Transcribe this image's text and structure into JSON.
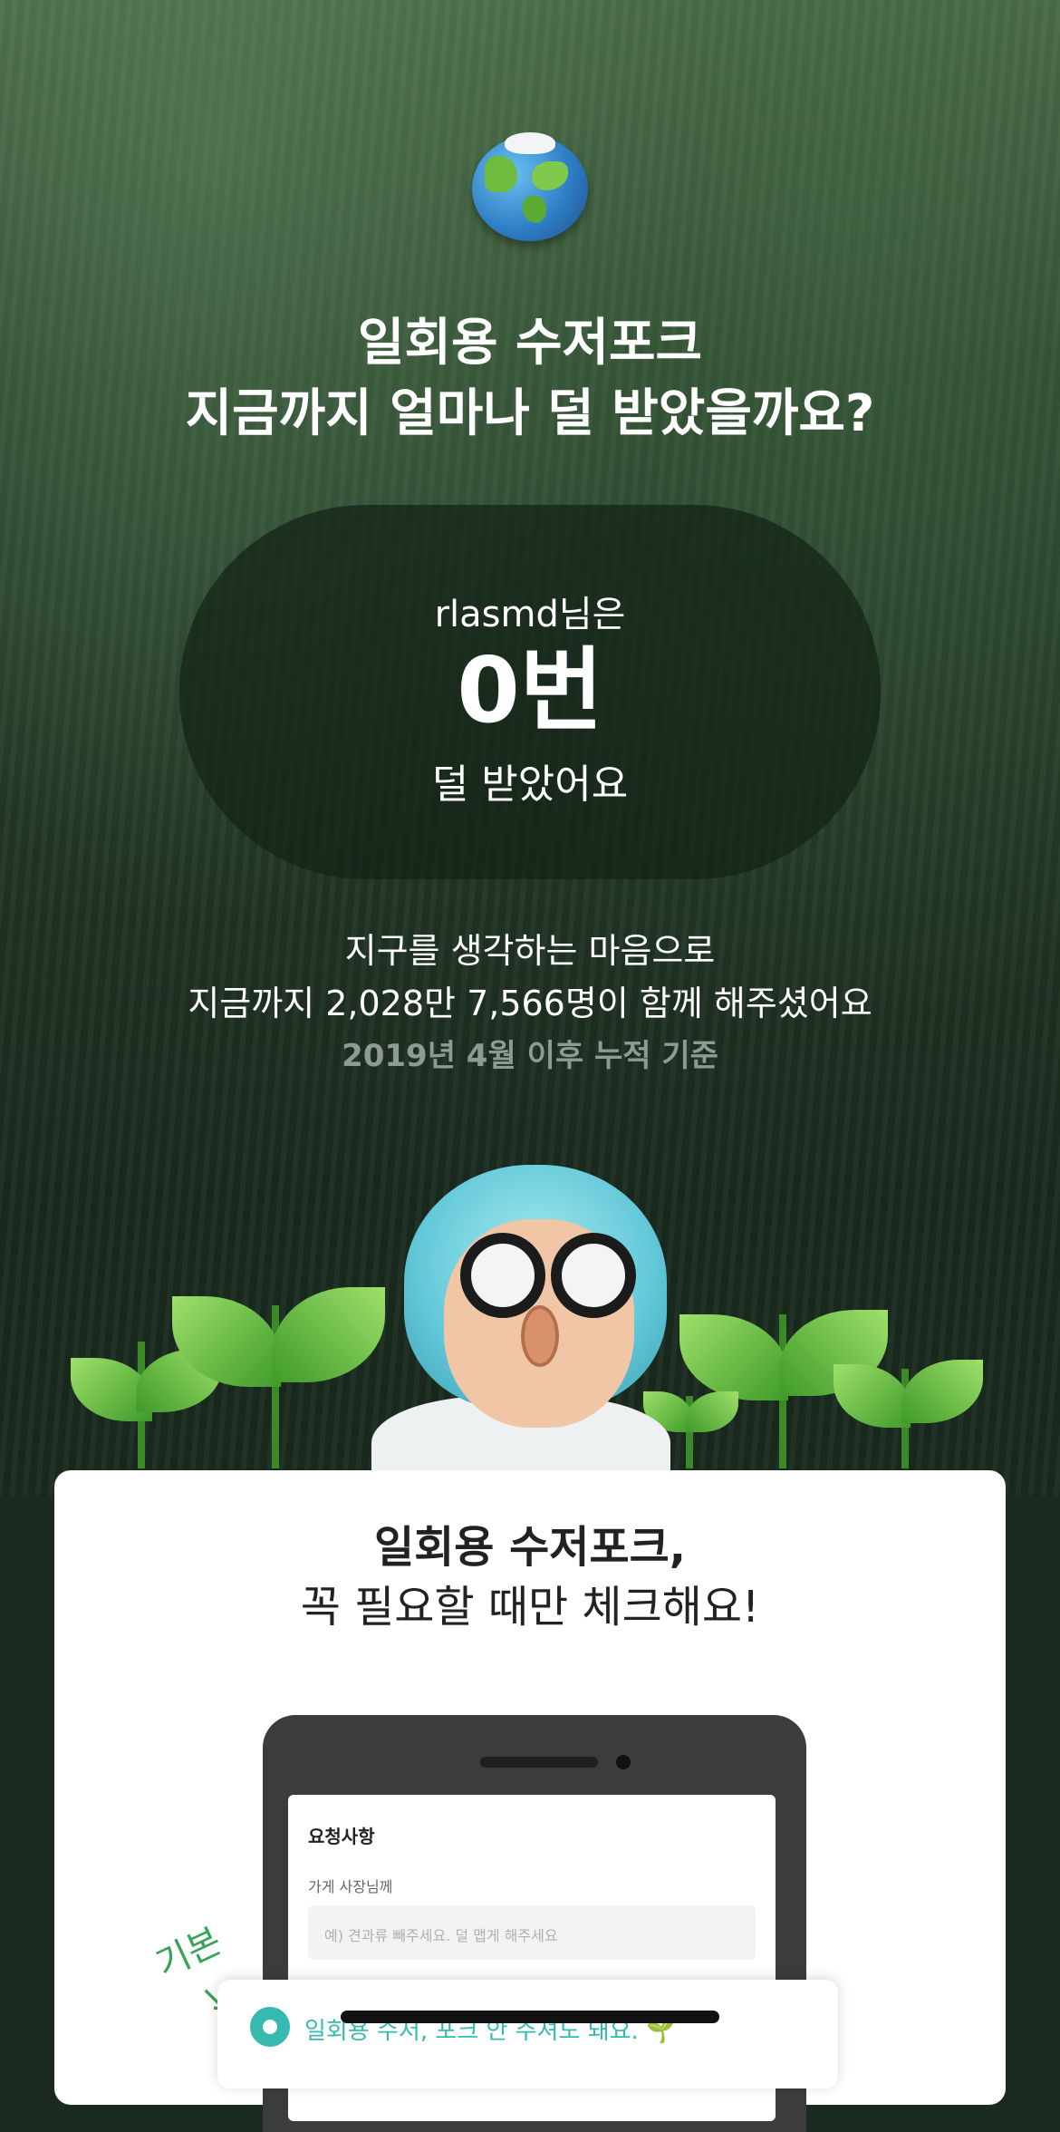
{
  "hero": {
    "title_line1": "일회용 수저포크",
    "title_line2": "지금까지 얼마나 덜 받았을까요?",
    "user_line": "rlasmd님은",
    "count": "0번",
    "count_suffix": "덜 받았어요",
    "stats_line1": "지구를 생각하는 마음으로",
    "stats_line2": "지금까지 2,028만 7,566명이 함께 해주셨어요",
    "stats_basis": "2019년 4월 이후 누적 기준"
  },
  "card": {
    "title_bold": "일회용 수저포크,",
    "title_line2": "꼭 필요할 때만 체크해요!",
    "screen": {
      "heading": "요청사항",
      "label": "가게 사장님께",
      "placeholder": "예) 견과류 빼주세요. 덜 맵게 해주세요"
    },
    "option_text": "일회용 수저, 포크 안 주셔도 돼요. 🌱",
    "handwritten": "기본"
  },
  "colors": {
    "accent": "#35b9b0",
    "forest_dark": "#1a2a1e",
    "handwriting": "#3aa35a"
  }
}
